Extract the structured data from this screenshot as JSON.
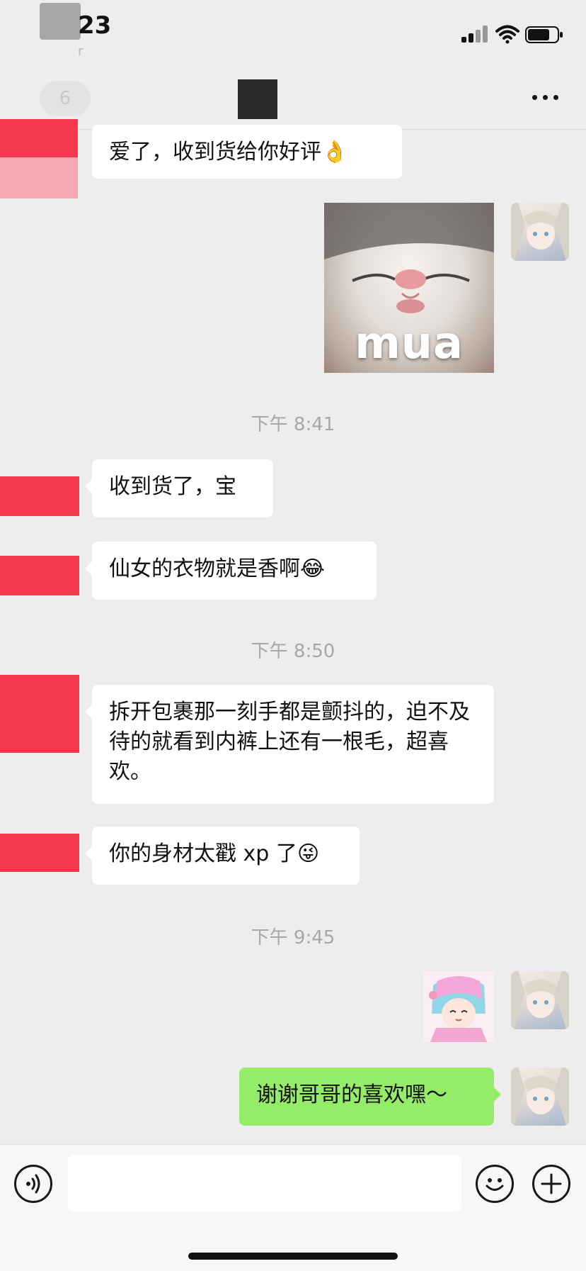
{
  "status_bar": {
    "time": "23",
    "sub_text": "r"
  },
  "nav": {
    "back_badge": "6"
  },
  "messages": {
    "m1": "爱了，收到货给你好评",
    "m1_emoji": "👌",
    "sticker_mua": "mua",
    "ts1": "下午 8:41",
    "m2": "收到货了，宝",
    "m3": "仙女的衣物就是香啊",
    "m3_emoji": "😂",
    "ts2": "下午 8:50",
    "m4": "拆开包裹那一刻手都是颤抖的，迫不及待的就看到内裤上还有一根毛，超喜欢。",
    "m5": "你的身材太戳 xp 了",
    "m5_emoji": "😜",
    "ts3": "下午 9:45",
    "m6": "谢谢哥哥的喜欢嘿～"
  },
  "input": {
    "placeholder": ""
  },
  "colors": {
    "background": "#ededed",
    "bubble_self": "#95ec69",
    "bubble_other": "#ffffff",
    "avatar_redacted": "#f5384e"
  },
  "icons": [
    "signal-icon",
    "wifi-icon",
    "battery-icon",
    "more-icon",
    "voice-icon",
    "emoji-icon",
    "plus-icon"
  ]
}
